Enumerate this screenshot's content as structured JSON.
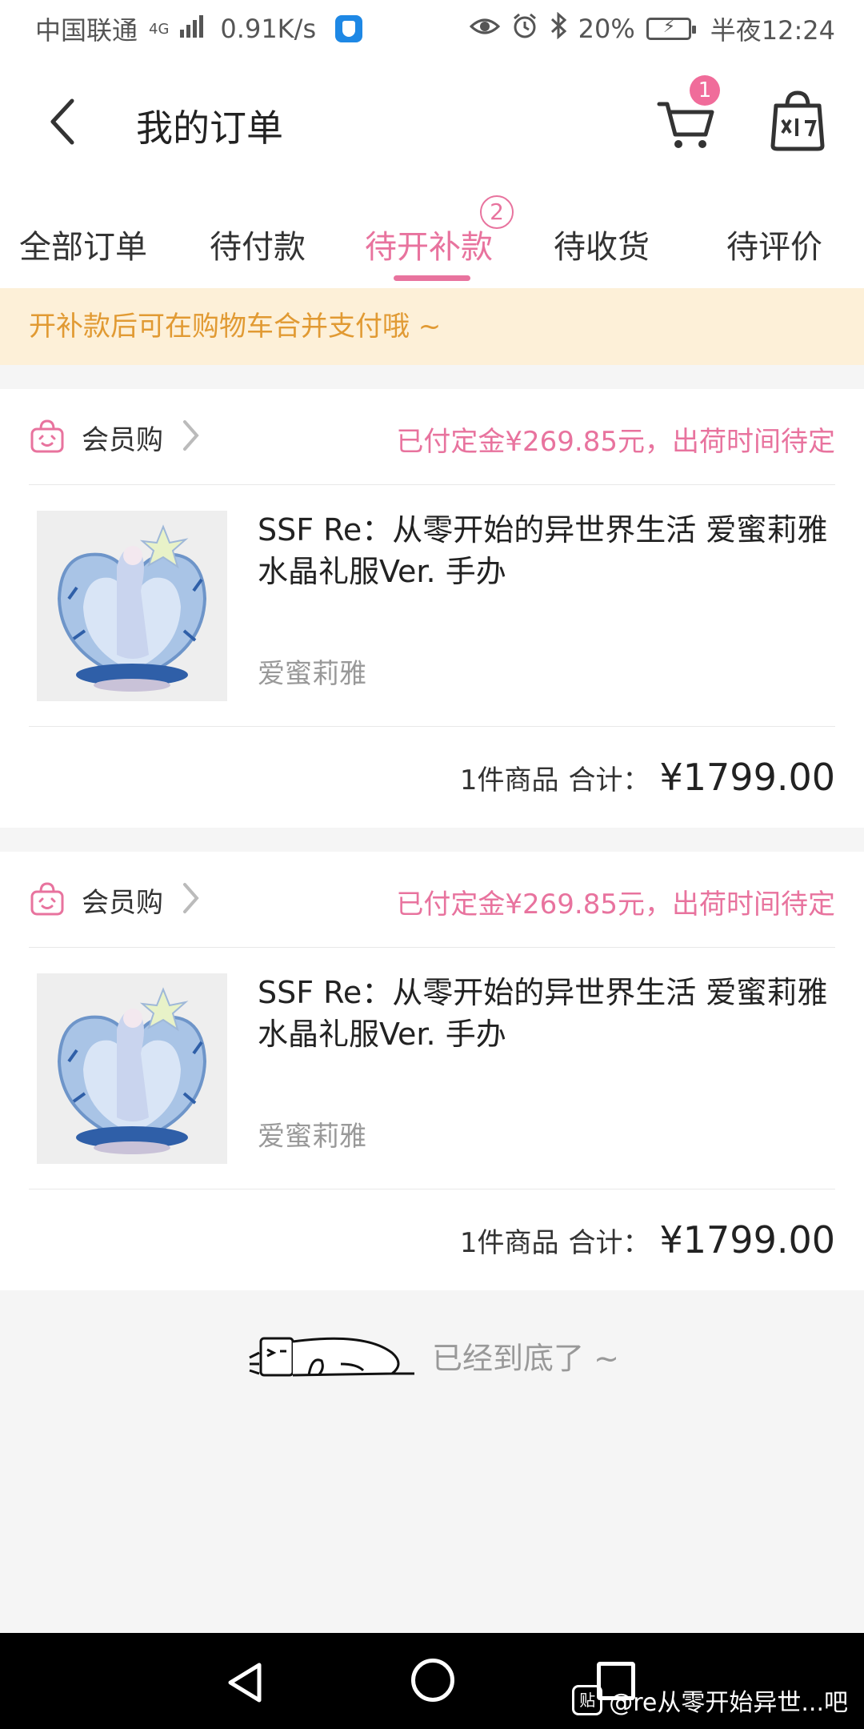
{
  "status_bar": {
    "carrier": "中国联通",
    "network_type": "4G",
    "speed": "0.91K/s",
    "battery": "20%",
    "time": "半夜12:24",
    "icons": [
      "signal-icon",
      "shield-app-icon",
      "eye-icon",
      "alarm-icon",
      "bluetooth-icon",
      "battery-icon"
    ]
  },
  "header": {
    "title": "我的订单",
    "cart_badge": "1",
    "icons": [
      "back-arrow-icon",
      "cart-icon",
      "shopping-bag-icon"
    ]
  },
  "tabs": [
    {
      "label": "全部订单",
      "active": false
    },
    {
      "label": "待付款",
      "active": false
    },
    {
      "label": "待开补款",
      "active": true,
      "count": "2"
    },
    {
      "label": "待收货",
      "active": false
    },
    {
      "label": "待评价",
      "active": false
    }
  ],
  "notice": "开补款后可在购物车合并支付哦 ~",
  "orders": [
    {
      "shop": "会员购",
      "status": "已付定金¥269.85元，出荷时间待定",
      "product_title": "SSF Re：从零开始的异世界生活 爱蜜莉雅 水晶礼服Ver. 手办",
      "variant": "爱蜜莉雅",
      "qty_label": "1件商品",
      "total_label": "合计：",
      "total_price": "¥1799.00"
    },
    {
      "shop": "会员购",
      "status": "已付定金¥269.85元，出荷时间待定",
      "product_title": "SSF Re：从零开始的异世界生活 爱蜜莉雅 水晶礼服Ver. 手办",
      "variant": "爱蜜莉雅",
      "qty_label": "1件商品",
      "total_label": "合计：",
      "total_price": "¥1799.00"
    }
  ],
  "end_text": "已经到底了 ~",
  "nav_bar": {
    "watermark": "@re从零开始异世...吧",
    "watermark_logo": "贴"
  },
  "colors": {
    "accent": "#e8739e",
    "notice_bg": "#fdf0d8",
    "notice_text": "#e19a33",
    "page_bg": "#f5f5f5"
  }
}
